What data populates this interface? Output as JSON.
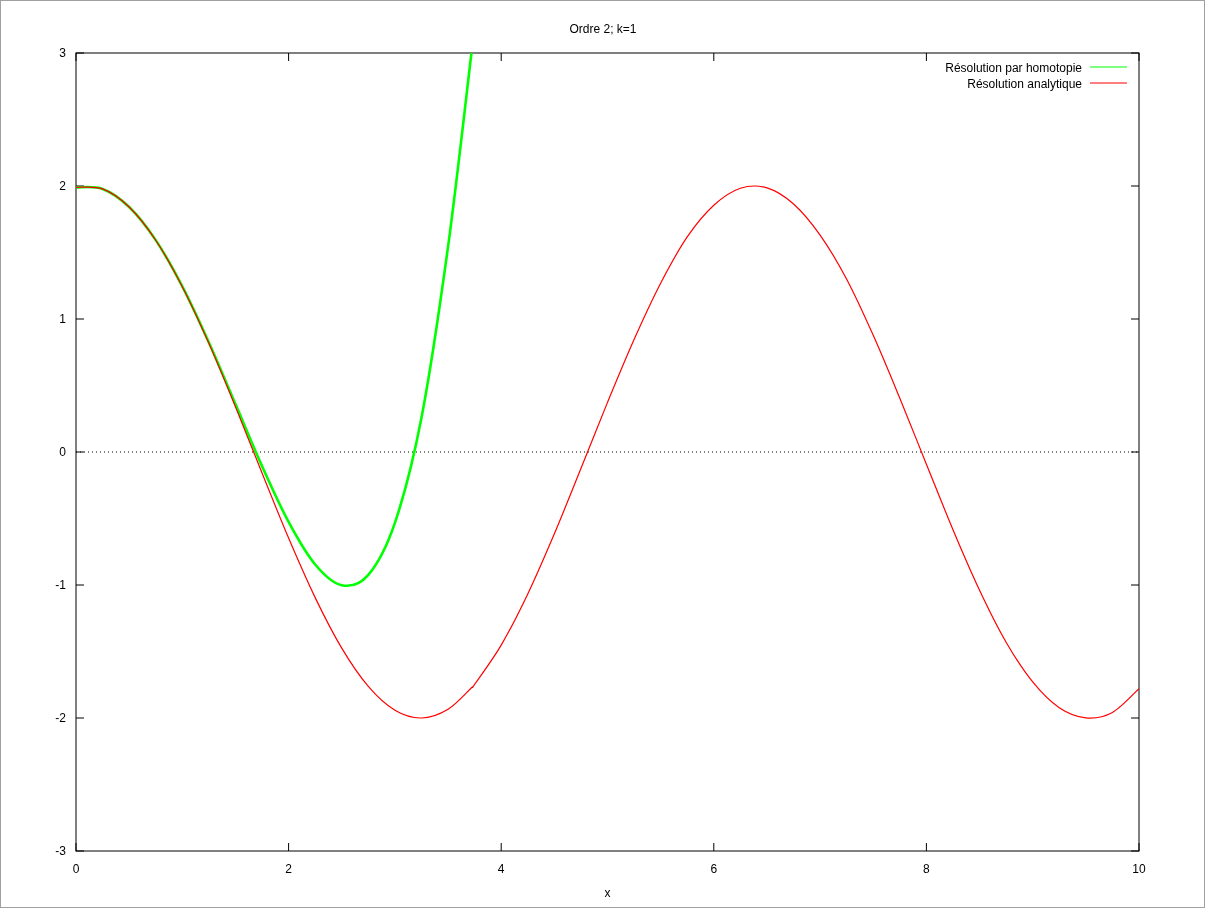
{
  "plot": {
    "chart_data": {
      "type": "line",
      "title": "Ordre 2; k=1",
      "xlabel": "x",
      "x": [
        0,
        0.25,
        0.5,
        0.75,
        1,
        1.25,
        1.5,
        1.75,
        2,
        2.25,
        2.5,
        2.75,
        3,
        3.25,
        3.5,
        3.72,
        3.75,
        4,
        4.25,
        4.5,
        4.75,
        5,
        5.25,
        5.5,
        5.75,
        6,
        6.25,
        6.5,
        6.75,
        7,
        7.25,
        7.5,
        7.75,
        8,
        8.25,
        8.5,
        8.75,
        9,
        9.25,
        9.5,
        9.75,
        10
      ],
      "series": [
        {
          "name": "Résolution par homotopie",
          "color": "#00ff00",
          "values": [
            1.99,
            1.978,
            1.842,
            1.593,
            1.245,
            0.823,
            0.36,
            -0.106,
            -0.526,
            -0.846,
            -1.002,
            -0.924,
            -0.533,
            0.257,
            1.544,
            3.0,
            null,
            null,
            null,
            null,
            null,
            null,
            null,
            null,
            null,
            null,
            null,
            null,
            null,
            null,
            null,
            null,
            null,
            null,
            null,
            null,
            null,
            null,
            null,
            null,
            null,
            null
          ]
        },
        {
          "name": "Résolution analytique",
          "color": "#ff0000",
          "values": [
            1.99,
            1.978,
            1.842,
            1.592,
            1.243,
            0.817,
            0.34,
            -0.158,
            -0.647,
            -1.095,
            -1.475,
            -1.763,
            -1.942,
            -2.0,
            -1.934,
            -1.773,
            -1.747,
            -1.452,
            -1.067,
            -0.615,
            -0.124,
            0.373,
            0.846,
            1.269,
            1.617,
            1.855,
            1.983,
            1.986,
            1.865,
            1.631,
            1.299,
            0.877,
            0.404,
            -0.092,
            -0.584,
            -1.039,
            -1.43,
            -1.729,
            -1.923,
            -1.999,
            -1.958,
            -1.779
          ]
        }
      ],
      "legend": true,
      "xlim": [
        0,
        10
      ],
      "ylim": [
        -3,
        3
      ],
      "xticks": [
        0,
        2,
        4,
        6,
        8,
        10
      ],
      "yticks": [
        -3,
        -2,
        -1,
        0,
        1,
        2,
        3
      ]
    }
  }
}
